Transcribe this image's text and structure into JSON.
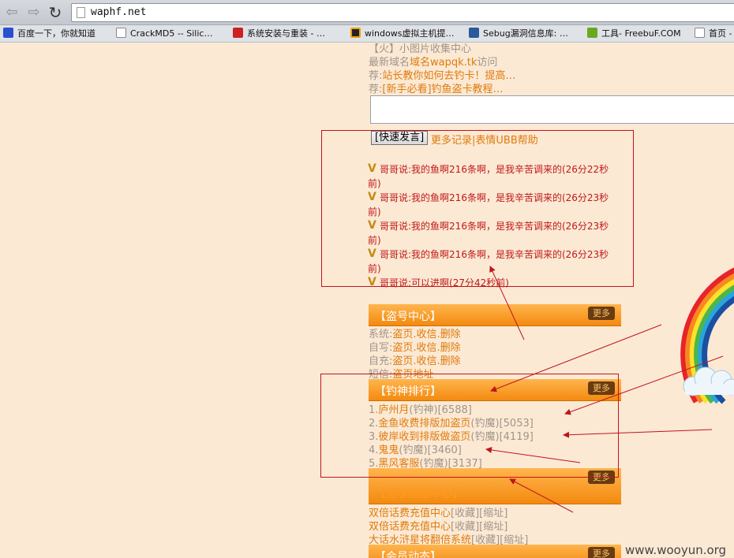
{
  "browser": {
    "url": "waphf.net",
    "bookmarks": [
      {
        "label": "百度一下，你就知道",
        "icon": "baidu-paw-icon",
        "color": "#2a4fd0"
      },
      {
        "label": "CrackMD5 -- Silic…",
        "icon": "page-icon",
        "color": "#888888"
      },
      {
        "label": "系统安装与重装 - …",
        "icon": "puzzle-icon",
        "color": "#cc2222"
      },
      {
        "label": "windows虚拟主机提…",
        "icon": "m-logo-icon",
        "color": "#f0a000"
      },
      {
        "label": "Sebug漏洞信息库: …",
        "icon": "s-logo-icon",
        "color": "#2a5a9a"
      },
      {
        "label": "工具- FreebuF.COM",
        "icon": "f-logo-icon",
        "color": "#6aa820"
      },
      {
        "label": "首页 -",
        "icon": "page-icon",
        "color": "#888888"
      }
    ]
  },
  "page": {
    "top_line": "【火】小图片收集中心",
    "domain_prefix": "最新域名",
    "domain_link": "域名wapqk.tk",
    "domain_suffix": "访问",
    "rec1_prefix": "荐:",
    "rec1_link": "站长教你如何去钓卡！提高…",
    "rec2_prefix": "荐:",
    "rec2_link": "[新手必看]钓鱼盗卡教程…",
    "quick_post_button": "[快速发言]",
    "more_links": "更多记录|表情UBB帮助",
    "chat": [
      {
        "line1": "哥哥说:我的鱼啊216条啊，是我辛苦调来的(26分22秒",
        "line2": "前)"
      },
      {
        "line1": "哥哥说:我的鱼啊216条啊，是我辛苦调来的(26分23秒",
        "line2": "前)"
      },
      {
        "line1": "哥哥说:我的鱼啊216条啊，是我辛苦调来的(26分23秒",
        "line2": "前)"
      },
      {
        "line1": "哥哥说:我的鱼啊216条啊，是我辛苦调来的(26分23秒",
        "line2": "前)"
      },
      {
        "line1": "哥哥说:可以进啊(27分42秒前)",
        "line2": ""
      }
    ],
    "section_theft": {
      "title": "【盗号中心】",
      "more": "更多",
      "rows": [
        {
          "label": "系统:",
          "links": "盗页.收信.删除"
        },
        {
          "label": "自写:",
          "links": "盗页.收信.删除"
        },
        {
          "label": "自充:",
          "links": "盗页.收信.删除"
        },
        {
          "label": "短信:",
          "links": "盗页地址"
        }
      ]
    },
    "section_rank": {
      "title": "【钓神排行】",
      "more": "更多",
      "rows": [
        {
          "rank": "1.",
          "name": "庐州月",
          "title": "(钓神)",
          "score": "[6588]"
        },
        {
          "rank": "2.",
          "name": "金鱼收费排版加盗页",
          "title": "(钓魔)",
          "score": "[5053]"
        },
        {
          "rank": "3.",
          "name": "彼岸收到排版做盗页",
          "title": "(钓魔)",
          "score": "[4119]"
        },
        {
          "rank": "4.",
          "name": "鬼鬼",
          "title": "(钓魔)",
          "score": "[3460]"
        },
        {
          "rank": "5.",
          "name": "黑风客服",
          "title": "(钓魔)",
          "score": "[3137]"
        }
      ]
    },
    "section_share": {
      "title": "【分享资源中心】",
      "more": "更多",
      "rows": [
        {
          "name": "双倍话费充值中心",
          "a": "[收藏]",
          "b": "[缩址]"
        },
        {
          "name": "双倍话费充值中心",
          "a": "[收藏]",
          "b": "[缩址]"
        },
        {
          "name": "大话水浒星将翻倍系统",
          "a": "[收藏]",
          "b": "[缩址]"
        }
      ]
    },
    "section_member": {
      "title": "【会员动态】",
      "more": "更多"
    }
  },
  "watermark": "www.wooyun.org",
  "colors": {
    "annotation_red": "#c0141c",
    "link_orange": "#e07b0c",
    "chat_red": "#c01818"
  }
}
